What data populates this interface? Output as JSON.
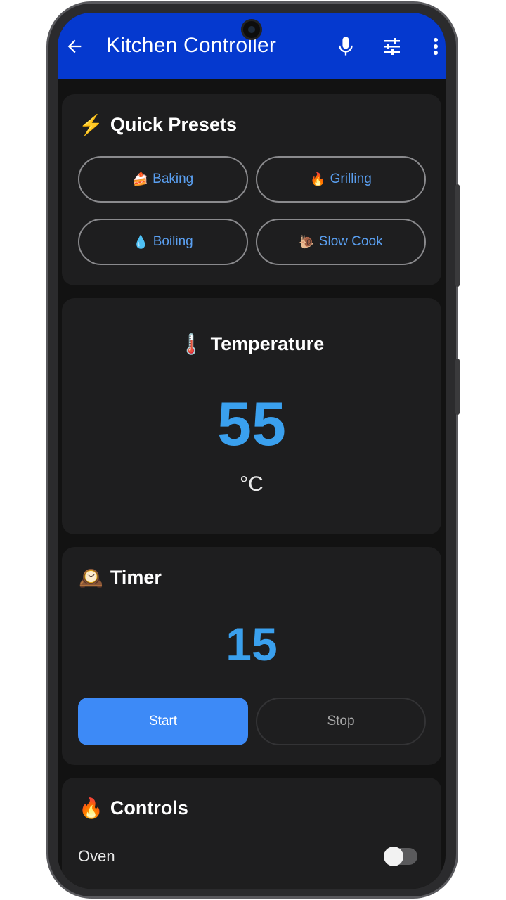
{
  "appbar": {
    "title": "Kitchen Controller",
    "icons": [
      "back-arrow-icon",
      "microphone-icon",
      "tune-sliders-icon",
      "more-vert-icon"
    ],
    "color": "#0539cf"
  },
  "presets": {
    "title": "Quick Presets",
    "title_emoji": "⚡",
    "items": [
      {
        "emoji": "🍰",
        "label": "Baking"
      },
      {
        "emoji": "🔥",
        "label": "Grilling"
      },
      {
        "emoji": "💧",
        "label": "Boiling"
      },
      {
        "emoji": "🐌",
        "label": "Slow Cook"
      }
    ]
  },
  "temperature": {
    "title": "Temperature",
    "title_emoji": "🌡️",
    "value": "55",
    "unit": "°C"
  },
  "timer": {
    "title": "Timer",
    "title_emoji": "🕰️",
    "value": "15",
    "start_label": "Start",
    "stop_label": "Stop"
  },
  "controls": {
    "title": "Controls",
    "title_emoji": "🔥",
    "oven_label": "Oven",
    "oven_on": false
  },
  "colors": {
    "accent": "#3aa0ee",
    "button_primary": "#3d8af7",
    "card_bg": "#1e1e1f",
    "screen_bg": "#121212"
  }
}
